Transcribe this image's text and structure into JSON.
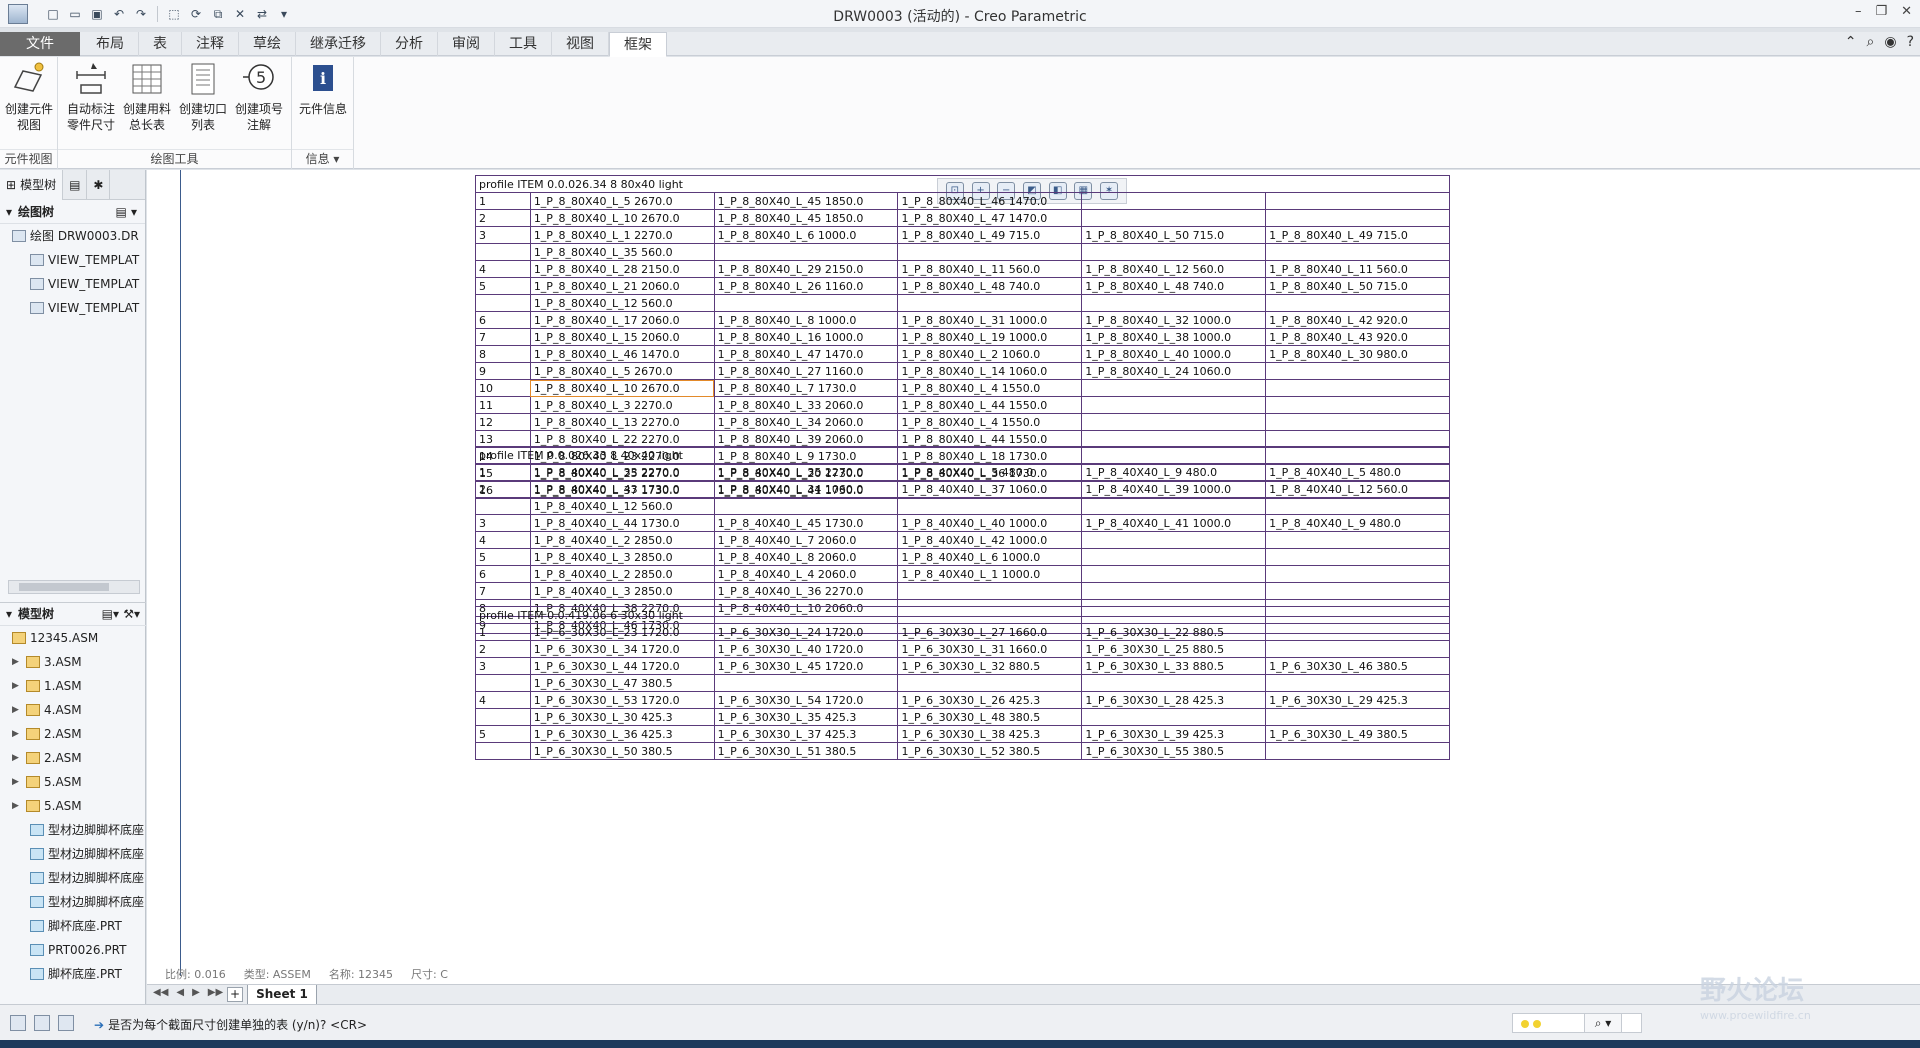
{
  "window": {
    "title": "DRW0003 (活动的) - Creo Parametric"
  },
  "ribbon": {
    "file_tab": "文件",
    "tabs": [
      "布局",
      "表",
      "注释",
      "草绘",
      "继承迁移",
      "分析",
      "审阅",
      "工具",
      "视图",
      "框架"
    ],
    "active_tab": "框架",
    "groups": [
      {
        "label": "元件视图",
        "buttons": [
          "创建元件\n视图"
        ]
      },
      {
        "label": "绘图工具",
        "buttons": [
          "自动标注\n零件尺寸",
          "创建用料\n总长表",
          "创建切口\n列表",
          "创建项号\n注解"
        ]
      },
      {
        "label": "信息",
        "buttons": [
          "元件信息"
        ]
      }
    ]
  },
  "left_panel": {
    "tabs": [
      "模型树"
    ],
    "drawing_tree_header": "绘图树",
    "drawing_tree": [
      "绘图 DRW0003.DR",
      "VIEW_TEMPLAT",
      "VIEW_TEMPLAT",
      "VIEW_TEMPLAT"
    ],
    "model_tree_header": "模型树",
    "model_tree": [
      {
        "label": "12345.ASM",
        "kind": "asm",
        "expandable": false
      },
      {
        "label": "3.ASM",
        "kind": "asm",
        "expandable": true
      },
      {
        "label": "1.ASM",
        "kind": "asm",
        "expandable": true
      },
      {
        "label": "4.ASM",
        "kind": "asm",
        "expandable": true
      },
      {
        "label": "2.ASM",
        "kind": "asm",
        "expandable": true
      },
      {
        "label": "2.ASM",
        "kind": "asm",
        "expandable": true
      },
      {
        "label": "5.ASM",
        "kind": "asm",
        "expandable": true
      },
      {
        "label": "5.ASM",
        "kind": "asm",
        "expandable": true
      },
      {
        "label": "型材边脚脚杯底座",
        "kind": "prt",
        "expandable": false
      },
      {
        "label": "型材边脚脚杯底座",
        "kind": "prt",
        "expandable": false
      },
      {
        "label": "型材边脚脚杯底座",
        "kind": "prt",
        "expandable": false
      },
      {
        "label": "型材边脚脚杯底座",
        "kind": "prt",
        "expandable": false
      },
      {
        "label": "脚杯底座.PRT",
        "kind": "prt",
        "expandable": false
      },
      {
        "label": "PRT0026.PRT",
        "kind": "prt",
        "expandable": false
      },
      {
        "label": "脚杯底座.PRT",
        "kind": "prt",
        "expandable": false
      }
    ]
  },
  "tables": [
    {
      "title": "profile ITEM 0.0.026.34 8 80x40 light",
      "rows": [
        [
          "1",
          "1_P_8_80X40_L_5 2670.0",
          "1_P_8_80X40_L_45 1850.0",
          "1_P_8_80X40_L_46 1470.0",
          "",
          ""
        ],
        [
          "2",
          "1_P_8_80X40_L_10 2670.0",
          "1_P_8_80X40_L_45 1850.0",
          "1_P_8_80X40_L_47 1470.0",
          "",
          ""
        ],
        [
          "3",
          "1_P_8_80X40_L_1 2270.0",
          "1_P_8_80X40_L_6 1000.0",
          "1_P_8_80X40_L_49 715.0",
          "1_P_8_80X40_L_50 715.0",
          "1_P_8_80X40_L_49 715.0"
        ],
        [
          "",
          "1_P_8_80X40_L_35 560.0",
          "",
          "",
          "",
          ""
        ],
        [
          "4",
          "1_P_8_80X40_L_28 2150.0",
          "1_P_8_80X40_L_29 2150.0",
          "1_P_8_80X40_L_11 560.0",
          "1_P_8_80X40_L_12 560.0",
          "1_P_8_80X40_L_11 560.0"
        ],
        [
          "5",
          "1_P_8_80X40_L_21 2060.0",
          "1_P_8_80X40_L_26 1160.0",
          "1_P_8_80X40_L_48 740.0",
          "1_P_8_80X40_L_48 740.0",
          "1_P_8_80X40_L_50 715.0"
        ],
        [
          "",
          "1_P_8_80X40_L_12 560.0",
          "",
          "",
          "",
          ""
        ],
        [
          "6",
          "1_P_8_80X40_L_17 2060.0",
          "1_P_8_80X40_L_8 1000.0",
          "1_P_8_80X40_L_31 1000.0",
          "1_P_8_80X40_L_32 1000.0",
          "1_P_8_80X40_L_42 920.0"
        ],
        [
          "7",
          "1_P_8_80X40_L_15 2060.0",
          "1_P_8_80X40_L_16 1000.0",
          "1_P_8_80X40_L_19 1000.0",
          "1_P_8_80X40_L_38 1000.0",
          "1_P_8_80X40_L_43 920.0"
        ],
        [
          "8",
          "1_P_8_80X40_L_46 1470.0",
          "1_P_8_80X40_L_47 1470.0",
          "1_P_8_80X40_L_2 1060.0",
          "1_P_8_80X40_L_40 1000.0",
          "1_P_8_80X40_L_30 980.0"
        ],
        [
          "9",
          "1_P_8_80X40_L_5 2670.0",
          "1_P_8_80X40_L_27 1160.0",
          "1_P_8_80X40_L_14 1060.0",
          "1_P_8_80X40_L_24 1060.0",
          ""
        ],
        [
          "10",
          "1_P_8_80X40_L_10 2670.0",
          "1_P_8_80X40_L_7 1730.0",
          "1_P_8_80X40_L_4 1550.0",
          "",
          ""
        ],
        [
          "11",
          "1_P_8_80X40_L_3 2270.0",
          "1_P_8_80X40_L_33 2060.0",
          "1_P_8_80X40_L_44 1550.0",
          "",
          ""
        ],
        [
          "12",
          "1_P_8_80X40_L_13 2270.0",
          "1_P_8_80X40_L_34 2060.0",
          "1_P_8_80X40_L_4 1550.0",
          "",
          ""
        ],
        [
          "13",
          "1_P_8_80X40_L_22 2270.0",
          "1_P_8_80X40_L_39 2060.0",
          "1_P_8_80X40_L_44 1550.0",
          "",
          ""
        ],
        [
          "14",
          "1_P_8_80X40_L_23 2270.0",
          "1_P_8_80X40_L_9 1730.0",
          "1_P_8_80X40_L_18 1730.0",
          "",
          ""
        ],
        [
          "15",
          "1_P_8_80X40_L_25 2270.0",
          "1_P_8_80X40_L_20 1730.0",
          "1_P_8_80X40_L_36 1730.0",
          "",
          ""
        ],
        [
          "16",
          "1_P_8_80X40_L_37 1730.0",
          "1_P_8_80X40_L_41 1730.0",
          "",
          "",
          ""
        ]
      ]
    },
    {
      "title": "profile ITEM 0.0.026.33 8 40x40 light",
      "rows": [
        [
          "1",
          "1_P_8_40X40_L_33 2270.0",
          "1_P_8_40X40_L_35 2270.0",
          "1_P_8_40X40_L_5 480.0",
          "1_P_8_40X40_L_9 480.0",
          "1_P_8_40X40_L_5 480.0"
        ],
        [
          "2",
          "1_P_8_40X40_L_43 1730.0",
          "1_P_8_40X40_L_34 1060.0",
          "1_P_8_40X40_L_37 1060.0",
          "1_P_8_40X40_L_39 1000.0",
          "1_P_8_40X40_L_12 560.0"
        ],
        [
          "",
          "1_P_8_40X40_L_12 560.0",
          "",
          "",
          "",
          ""
        ],
        [
          "3",
          "1_P_8_40X40_L_44 1730.0",
          "1_P_8_40X40_L_45 1730.0",
          "1_P_8_40X40_L_40 1000.0",
          "1_P_8_40X40_L_41 1000.0",
          "1_P_8_40X40_L_9 480.0"
        ],
        [
          "4",
          "1_P_8_40X40_L_2 2850.0",
          "1_P_8_40X40_L_7 2060.0",
          "1_P_8_40X40_L_42 1000.0",
          "",
          ""
        ],
        [
          "5",
          "1_P_8_40X40_L_3 2850.0",
          "1_P_8_40X40_L_8 2060.0",
          "1_P_8_40X40_L_6 1000.0",
          "",
          ""
        ],
        [
          "6",
          "1_P_8_40X40_L_2 2850.0",
          "1_P_8_40X40_L_4 2060.0",
          "1_P_8_40X40_L_1 1000.0",
          "",
          ""
        ],
        [
          "7",
          "1_P_8_40X40_L_3 2850.0",
          "1_P_8_40X40_L_36 2270.0",
          "",
          "",
          ""
        ],
        [
          "8",
          "1_P_8_40X40_L_38 2270.0",
          "1_P_8_40X40_L_10 2060.0",
          "",
          "",
          ""
        ],
        [
          "9",
          "1_P_8_40X40_L_46 1730.0",
          "",
          "",
          "",
          ""
        ]
      ]
    },
    {
      "title": "profile ITEM 0.0.419.06 6 30x30 light",
      "rows": [
        [
          "1",
          "1_P_6_30X30_L_23 1720.0",
          "1_P_6_30X30_L_24 1720.0",
          "1_P_6_30X30_L_27 1660.0",
          "1_P_6_30X30_L_22 880.5",
          ""
        ],
        [
          "2",
          "1_P_6_30X30_L_34 1720.0",
          "1_P_6_30X30_L_40 1720.0",
          "1_P_6_30X30_L_31 1660.0",
          "1_P_6_30X30_L_25 880.5",
          ""
        ],
        [
          "3",
          "1_P_6_30X30_L_44 1720.0",
          "1_P_6_30X30_L_45 1720.0",
          "1_P_6_30X30_L_32 880.5",
          "1_P_6_30X30_L_33 880.5",
          "1_P_6_30X30_L_46 380.5"
        ],
        [
          "",
          "1_P_6_30X30_L_47 380.5",
          "",
          "",
          "",
          ""
        ],
        [
          "4",
          "1_P_6_30X30_L_53 1720.0",
          "1_P_6_30X30_L_54 1720.0",
          "1_P_6_30X30_L_26 425.3",
          "1_P_6_30X30_L_28 425.3",
          "1_P_6_30X30_L_29 425.3"
        ],
        [
          "",
          "1_P_6_30X30_L_30 425.3",
          "1_P_6_30X30_L_35 425.3",
          "1_P_6_30X30_L_48 380.5",
          "",
          ""
        ],
        [
          "5",
          "1_P_6_30X30_L_36 425.3",
          "1_P_6_30X30_L_37 425.3",
          "1_P_6_30X30_L_38 425.3",
          "1_P_6_30X30_L_39 425.3",
          "1_P_6_30X30_L_49 380.5"
        ],
        [
          "",
          "1_P_6_30X30_L_50 380.5",
          "1_P_6_30X30_L_51 380.5",
          "1_P_6_30X30_L_52 380.5",
          "1_P_6_30X30_L_55 380.5",
          ""
        ]
      ]
    }
  ],
  "drawing_status": {
    "scale": "比例: 0.016",
    "type": "类型: ASSEM",
    "name": "名称: 12345",
    "size": "尺寸: C"
  },
  "sheet": {
    "label": "Sheet 1"
  },
  "message": "是否为每个截面尺寸创建单独的表 (y/n)?  <CR>",
  "watermark": {
    "title": "野火论坛",
    "url": "www.proewildfire.cn"
  }
}
